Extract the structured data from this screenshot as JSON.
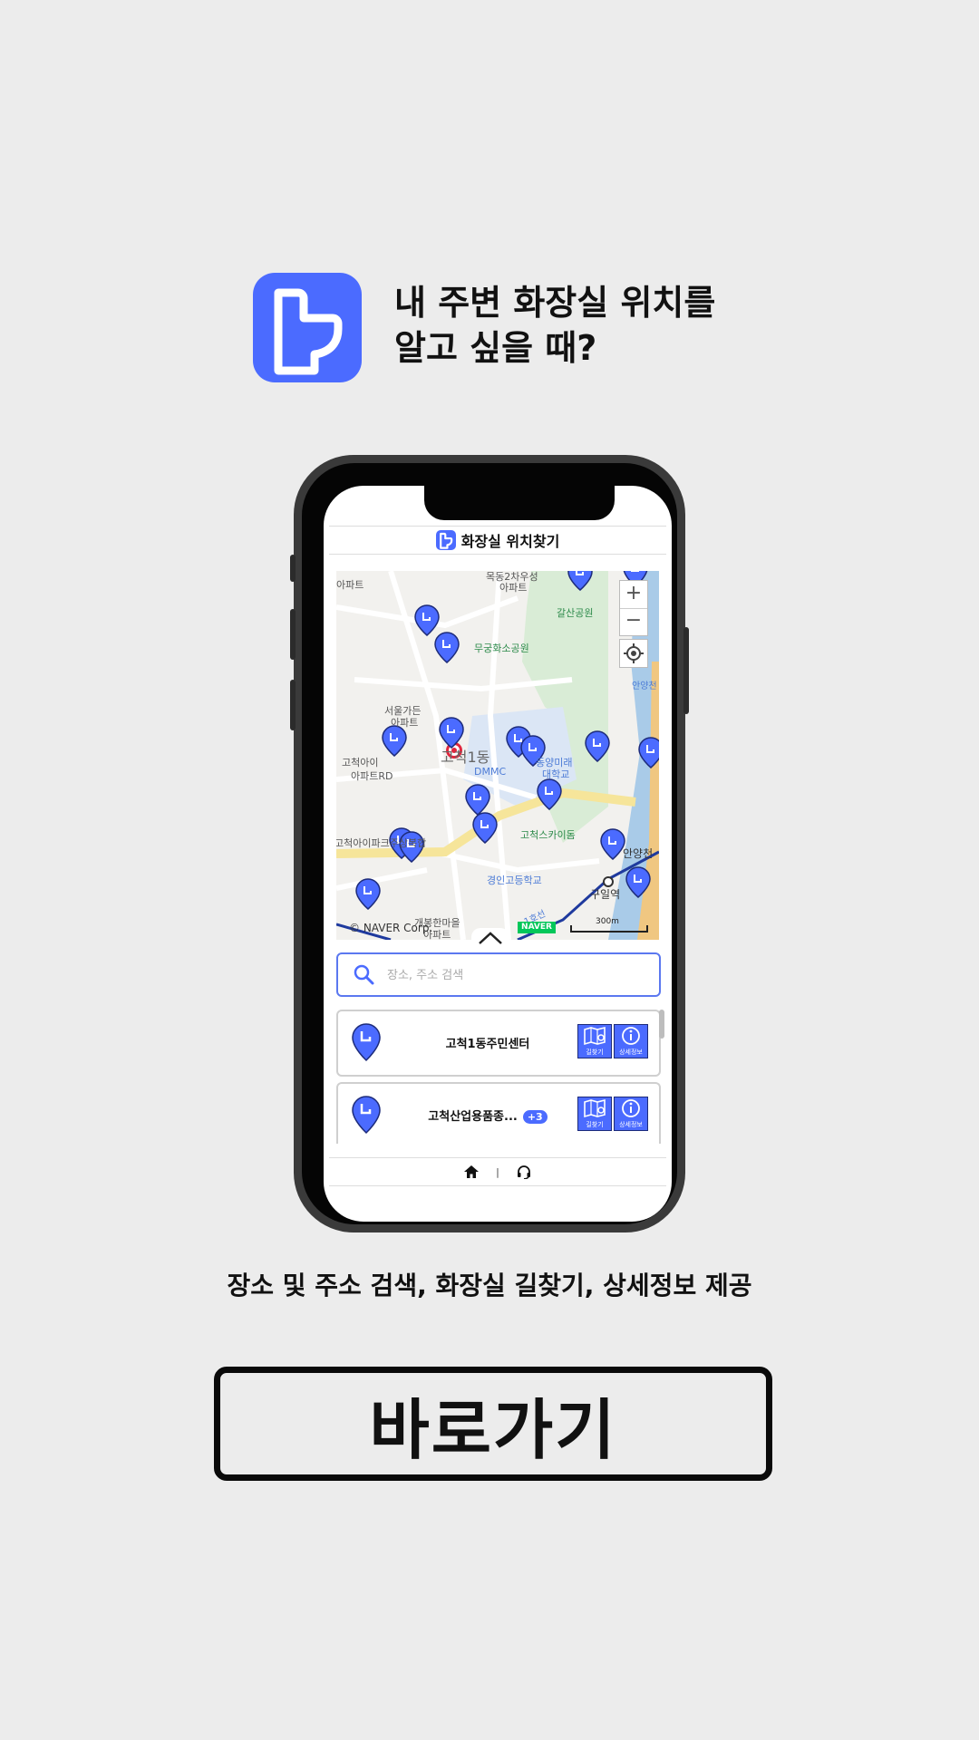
{
  "hero": {
    "title_line1": "내 주변 화장실 위치를",
    "title_line2": "알고 싶을 때?",
    "app_icon": "toilet-icon",
    "accent_color": "#4b6bff"
  },
  "app": {
    "title": "화장실 위치찾기",
    "map": {
      "zoom_in": "+",
      "zoom_out": "−",
      "labels": {
        "apt_top": "아파트",
        "apt_top2": "목동2차우성",
        "apt_top3": "아파트",
        "park": "갈산공원",
        "mugunghwa": "무궁화소공원",
        "seoul_garden": "서울가든",
        "seoul_garden2": "아파트",
        "gocheok1": "고척1동",
        "dmmc": "DMMC",
        "dongyang": "동양미래",
        "dongyang2": "대학교",
        "gocheok_ai": "고척아이",
        "apt_rd": "아파트RD",
        "gocheok_sky": "고척스카이돔",
        "gocheok_i_park": "고척아이파크주상복합",
        "gyeongin": "경인고등학교",
        "guil": "구일역",
        "anyang": "안양천",
        "anyang2": "안양천",
        "gaebong": "개봉한마을",
        "gaebong2": "아파트",
        "line1": "1호선"
      },
      "copyright": "© NAVER Corp.",
      "naver": "NAVER",
      "scale": "300m"
    },
    "search": {
      "placeholder": "장소, 주소 검색"
    },
    "results": [
      {
        "name": "고척1동주민센터",
        "badge": "",
        "route_label": "길찾기",
        "info_label": "상세정보"
      },
      {
        "name": "고척산업용품종...",
        "badge": "+3",
        "route_label": "길찾기",
        "info_label": "상세정보"
      }
    ],
    "nav": {
      "home_icon": "home-icon",
      "separator": "|",
      "support_icon": "headset-icon"
    }
  },
  "tagline": "장소 및 주소 검색, 화장실 길찾기, 상세정보 제공",
  "cta_label": "바로가기"
}
